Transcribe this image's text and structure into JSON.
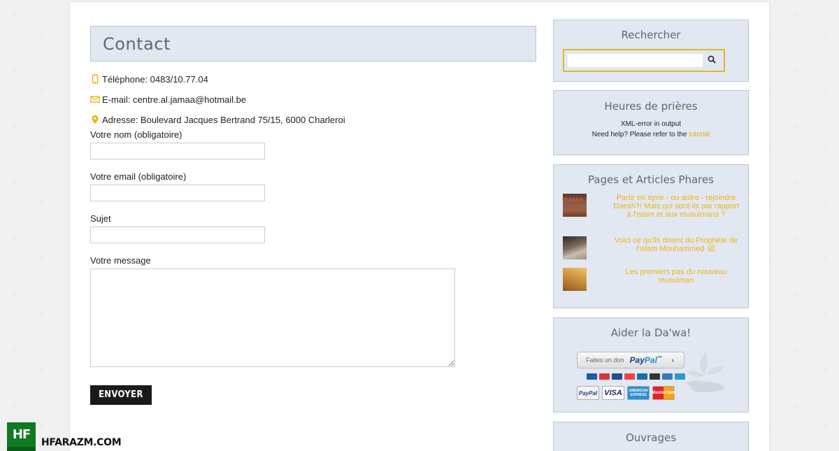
{
  "contact": {
    "title": "Contact",
    "phone": "Téléphone: 0483/10.77.04",
    "email": "E-mail: centre.al.jamaa@hotmail.be",
    "address": "Adresse: Boulevard Jacques Bertrand 75/15, 6000 Charleroi"
  },
  "form": {
    "name_label": "Votre nom (obligatoire)",
    "email_label": "Votre email (obligatoire)",
    "subject_label": "Sujet",
    "message_label": "Votre message",
    "name_value": "",
    "email_value": "",
    "subject_value": "",
    "message_value": "",
    "submit_label": "ENVOYER"
  },
  "sidebar": {
    "search": {
      "title": "Rechercher",
      "value": "",
      "icon": "search-icon"
    },
    "prayer": {
      "title": "Heures de prières",
      "error": "XML-error in output",
      "help": "Need help? Please refer to the",
      "help_link": "tutorial"
    },
    "pages": {
      "title": "Pages et Articles Phares",
      "items": [
        {
          "title": "Partir en syrie - ou autre - rejoindre Daesh?! Mais qui sont-ils par rapport à l'islam et aux musulmans ?",
          "thumb_text": "DAESH"
        },
        {
          "title": "Voici ce qu'ils disent du Prophète de l'islam Mouhammed ﷺ"
        },
        {
          "title": "Les premiers pas du nouveau musulman"
        }
      ]
    },
    "dawa": {
      "title": "Aider la Da'wa!",
      "paypal_small": "Faites un don",
      "paypal_brand_a": "Pay",
      "paypal_brand_b": "Pal",
      "paypal_tm": "™",
      "paypal_chevron": "›",
      "cards": [
        "PayPal",
        "VISA",
        "AMERICAN EXPRESS",
        "MasterCard"
      ]
    },
    "works": {
      "title": "Ouvrages"
    }
  },
  "watermark": {
    "logo": "HF",
    "name": "HFARAZM.COM"
  },
  "colors": {
    "accent": "#f0b216",
    "widget_bg": "#e1e8f2",
    "search_border": "#e5b626",
    "button_bg": "#1a1a1a",
    "watermark_green": "#0f7a22"
  }
}
